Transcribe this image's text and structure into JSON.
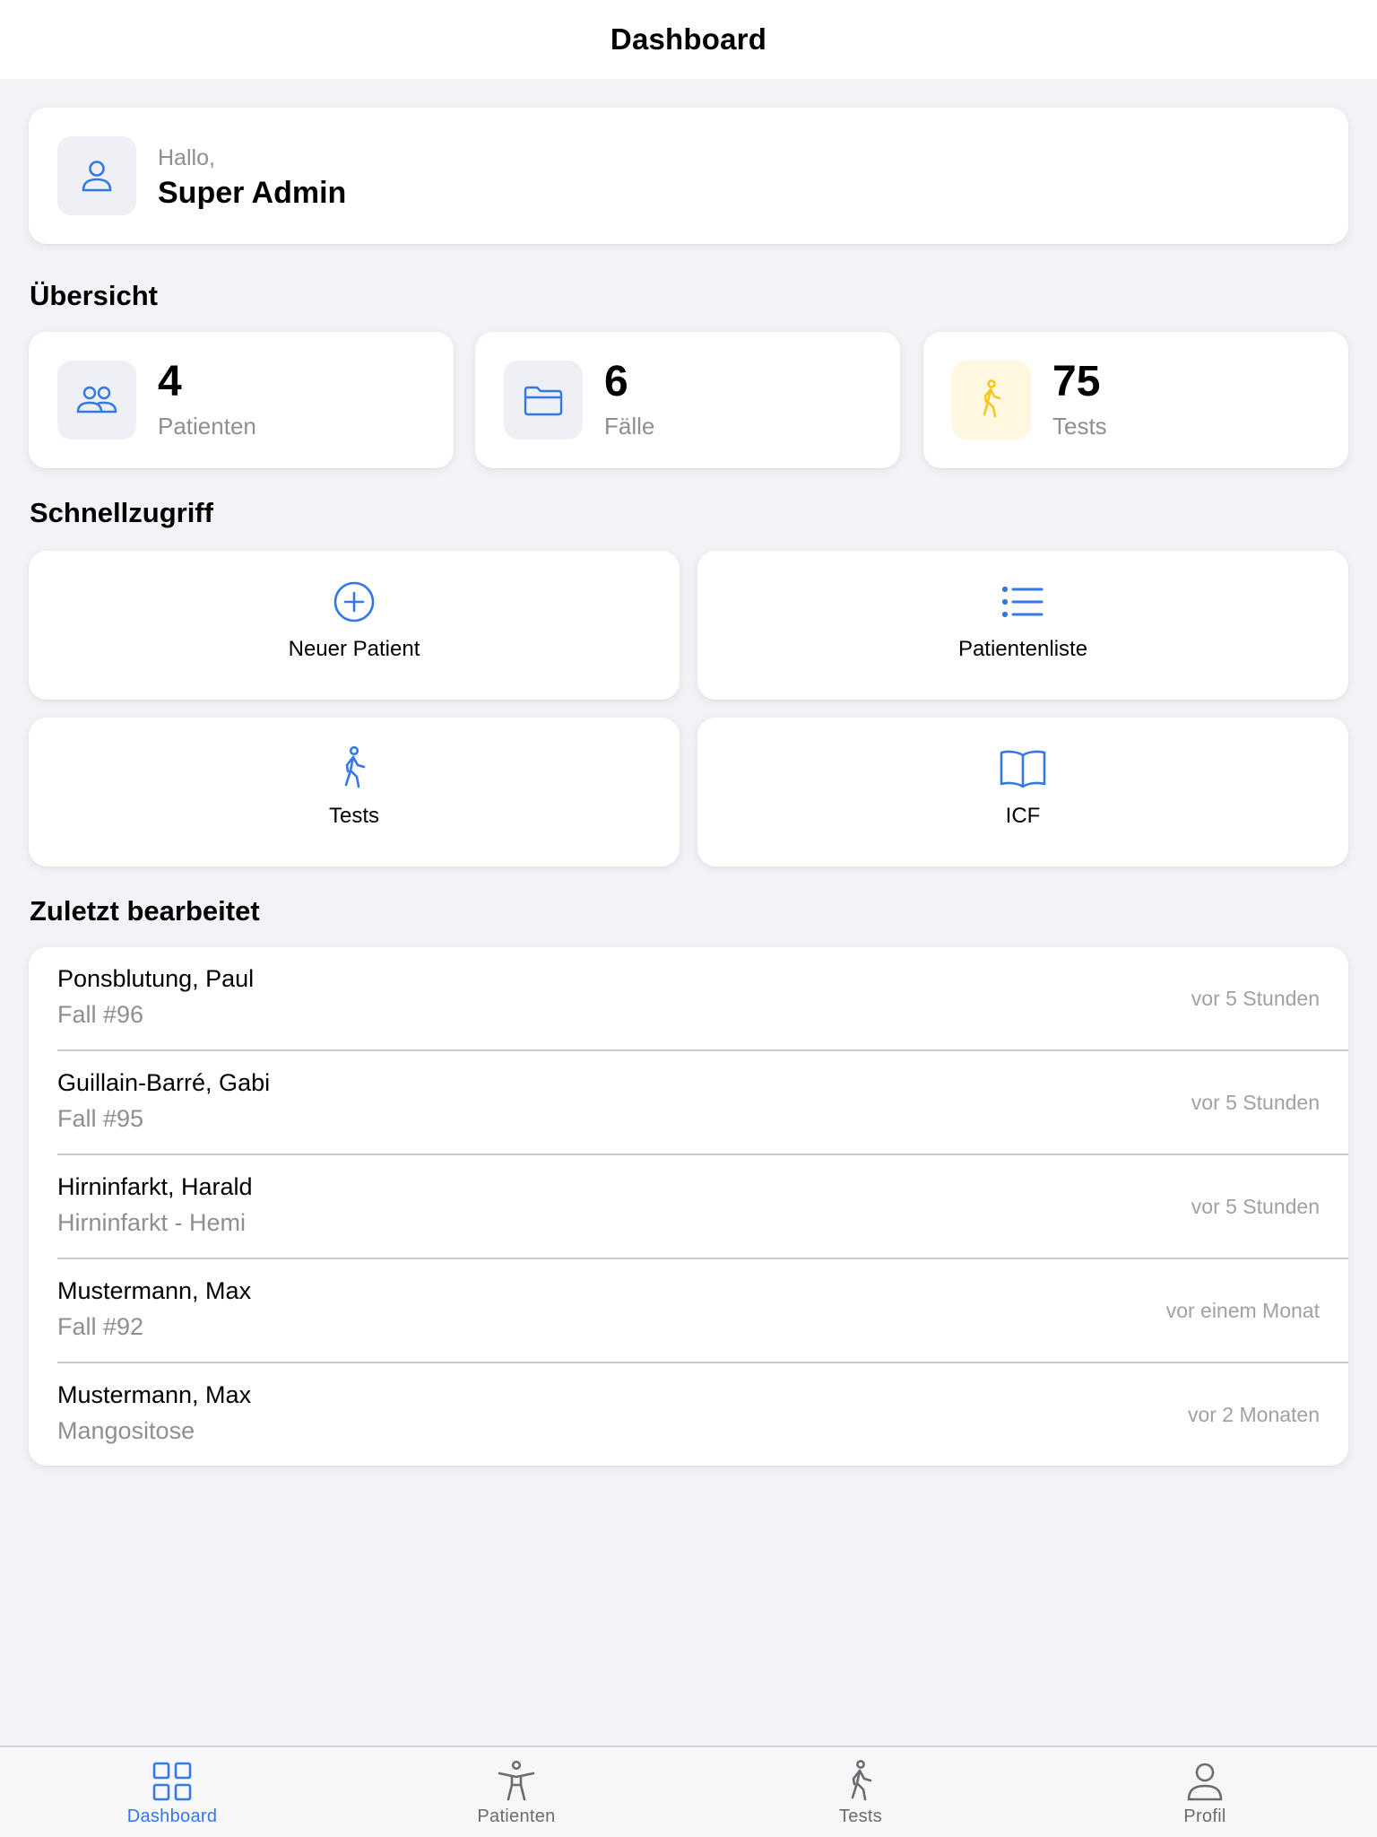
{
  "header": {
    "title": "Dashboard"
  },
  "greeting": {
    "hello": "Hallo,",
    "name": "Super Admin",
    "icon": "person-icon"
  },
  "overview": {
    "title": "Übersicht",
    "stats": [
      {
        "value": "4",
        "label": "Patienten",
        "icon": "people-icon"
      },
      {
        "value": "6",
        "label": "Fälle",
        "icon": "folder-icon"
      },
      {
        "value": "75",
        "label": "Tests",
        "icon": "walking-figure-icon"
      }
    ]
  },
  "quick_access": {
    "title": "Schnellzugriff",
    "items": [
      {
        "label": "Neuer Patient",
        "icon": "plus-circle-icon"
      },
      {
        "label": "Patientenliste",
        "icon": "list-icon"
      },
      {
        "label": "Tests",
        "icon": "walking-figure-icon"
      },
      {
        "label": "ICF",
        "icon": "book-icon"
      }
    ]
  },
  "recent": {
    "title": "Zuletzt bearbeitet",
    "items": [
      {
        "name": "Ponsblutung, Paul",
        "sub": "Fall #96",
        "time": "vor 5 Stunden"
      },
      {
        "name": "Guillain-Barré, Gabi",
        "sub": "Fall #95",
        "time": "vor 5 Stunden"
      },
      {
        "name": "Hirninfarkt, Harald",
        "sub": "Hirninfarkt - Hemi",
        "time": "vor 5 Stunden"
      },
      {
        "name": "Mustermann, Max",
        "sub": "Fall #92",
        "time": "vor einem Monat"
      },
      {
        "name": "Mustermann, Max",
        "sub": "Mangositose",
        "time": "vor 2 Monaten"
      }
    ]
  },
  "tabbar": {
    "active": "Dashboard",
    "items": [
      {
        "label": "Dashboard",
        "icon": "grid-icon"
      },
      {
        "label": "Patienten",
        "icon": "accessibility-figure-icon"
      },
      {
        "label": "Tests",
        "icon": "walking-figure-icon"
      },
      {
        "label": "Profil",
        "icon": "person-icon"
      }
    ]
  },
  "colors": {
    "accent": "#3478e6",
    "yellow": "#f5c518",
    "background": "#f2f3f7",
    "secondary_text": "#8e8e93"
  }
}
